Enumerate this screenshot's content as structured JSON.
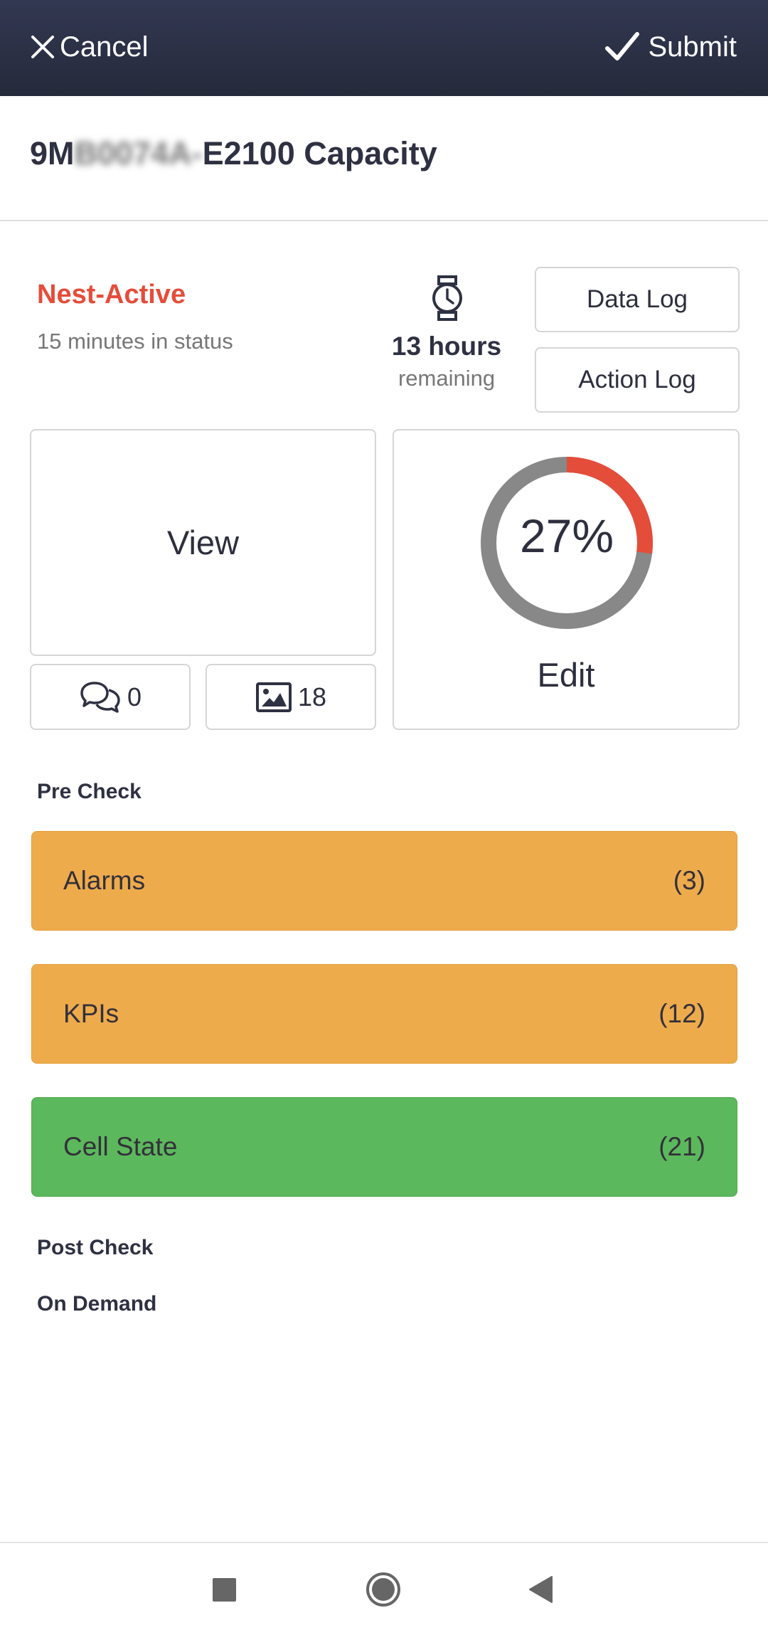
{
  "header": {
    "cancel_label": "Cancel",
    "submit_label": "Submit",
    "background": "#2b3044"
  },
  "title": {
    "prefix": "9M",
    "redacted": "B0074A-",
    "suffix": "E2100 Capacity"
  },
  "status": {
    "label": "Nest-Active",
    "time_in_status": "15 minutes in status",
    "color": "#e44d3a"
  },
  "timer": {
    "icon": "watch-icon",
    "value": "13 hours",
    "caption": "remaining"
  },
  "buttons": {
    "data_log": "Data Log",
    "action_log": "Action Log",
    "view": "View",
    "edit": "Edit",
    "comments_count": "0",
    "images_count": "18"
  },
  "progress": {
    "label": "27%",
    "percent": 27,
    "fill_color": "#e44d3a",
    "track_color": "#888888"
  },
  "sections": {
    "pre_check": "Pre Check",
    "post_check": "Post Check",
    "on_demand": "On Demand"
  },
  "checks": [
    {
      "label": "Alarms",
      "count": "(3)",
      "color": "#eeab4c"
    },
    {
      "label": "KPIs",
      "count": "(12)",
      "color": "#eeab4c"
    },
    {
      "label": "Cell State",
      "count": "(21)",
      "color": "#5cb85c"
    }
  ]
}
